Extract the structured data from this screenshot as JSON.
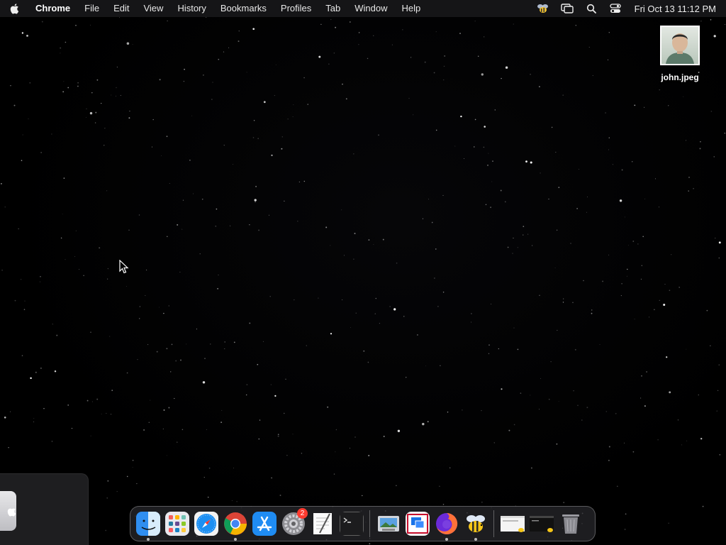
{
  "menubar": {
    "app_name": "Chrome",
    "items": [
      "File",
      "Edit",
      "View",
      "History",
      "Bookmarks",
      "Profiles",
      "Tab",
      "Window",
      "Help"
    ],
    "status_icons": [
      "bee-icon",
      "screen-mirroring-icon",
      "spotlight-search-icon",
      "control-center-icon"
    ],
    "clock": "Fri Oct 13  11:12 PM"
  },
  "desktop": {
    "file": {
      "label": "john.jpeg",
      "icon": "image-thumbnail"
    }
  },
  "dock": {
    "apps": [
      {
        "name": "Finder",
        "icon": "finder-icon",
        "running": true
      },
      {
        "name": "Launchpad",
        "icon": "launchpad-icon",
        "running": false
      },
      {
        "name": "Safari",
        "icon": "safari-icon",
        "running": false
      },
      {
        "name": "Google Chrome",
        "icon": "chrome-icon",
        "running": true
      },
      {
        "name": "App Store",
        "icon": "app-store-icon",
        "running": false
      },
      {
        "name": "System Settings",
        "icon": "settings-icon",
        "running": false,
        "badge": "2"
      },
      {
        "name": "TextEdit",
        "icon": "textedit-icon",
        "running": false
      },
      {
        "name": "Terminal",
        "icon": "terminal-icon",
        "running": false
      }
    ],
    "secondary": [
      {
        "name": "Preview",
        "icon": "preview-icon",
        "running": false
      },
      {
        "name": "Remote Desktop",
        "icon": "remote-desktop-icon",
        "running": false
      },
      {
        "name": "Firefox",
        "icon": "firefox-icon",
        "running": true
      },
      {
        "name": "Bee",
        "icon": "bee-app-icon",
        "running": true
      }
    ],
    "stack": [
      {
        "name": "Window 1",
        "icon": "minimized-window-icon"
      },
      {
        "name": "Window 2",
        "icon": "minimized-window-icon"
      },
      {
        "name": "Trash",
        "icon": "trash-icon"
      }
    ]
  },
  "colors": {
    "menubar_bg": "#161618",
    "desktop_bg": "#000000",
    "badge": "#ff3b30"
  }
}
